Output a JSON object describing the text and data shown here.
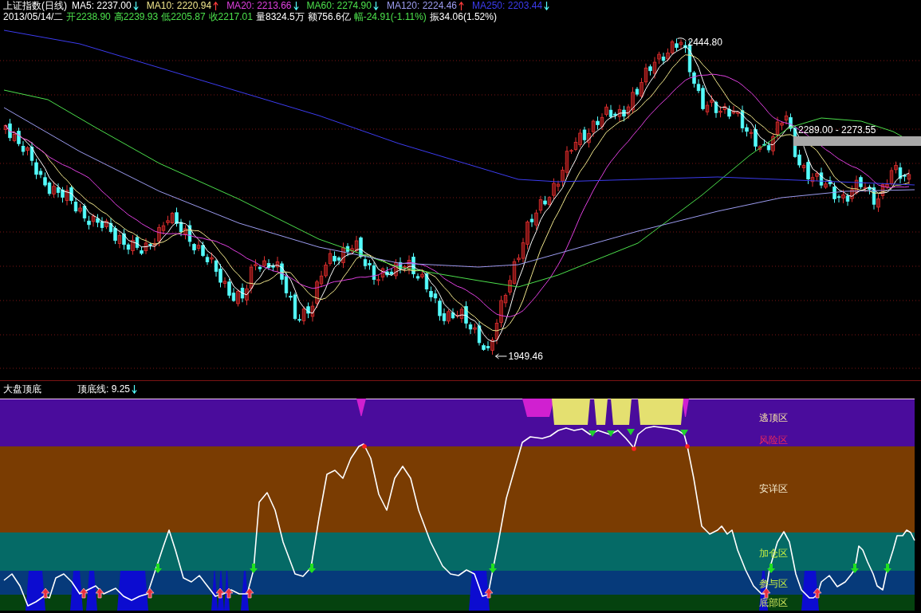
{
  "quote_header": {
    "title": "上证指数(日线)",
    "moving_averages": [
      {
        "label": "MA5: 2237.00",
        "color": "#ffffff",
        "rising": false
      },
      {
        "label": "MA10: 2220.94",
        "color": "#f0e68c",
        "rising": true
      },
      {
        "label": "MA20: 2213.66",
        "color": "#e040e0",
        "rising": false
      },
      {
        "label": "MA60: 2274.90",
        "color": "#4ce04c",
        "rising": false
      },
      {
        "label": "MA120: 2224.46",
        "color": "#9c9cf0",
        "rising": true
      },
      {
        "label": "MA250: 2203.44",
        "color": "#3c3cf0",
        "rising": false
      }
    ],
    "date": "2013/05/14/二",
    "fields": [
      {
        "text": "开2238.90",
        "color": "#4ce04c"
      },
      {
        "text": "高2239.93",
        "color": "#4ce04c"
      },
      {
        "text": "低2205.87",
        "color": "#4ce04c"
      },
      {
        "text": "收2217.01",
        "color": "#4ce04c"
      },
      {
        "text": "量8324.5万",
        "color": "#ffffff"
      },
      {
        "text": "额756.6亿",
        "color": "#ffffff"
      },
      {
        "text": "幅-24.91(-1.11%)",
        "color": "#4ce04c"
      },
      {
        "text": "振34.06(1.52%)",
        "color": "#ffffff"
      }
    ]
  },
  "price_chart": {
    "high_label": "2444.80",
    "low_label": "1949.46",
    "range_label": "2289.00 - 2273.55"
  },
  "indicator_panel": {
    "title": "大盘顶底",
    "line_label": "顶底线: 9.25",
    "rising": false,
    "zones": [
      {
        "color": "#4a0c9c",
        "labels": [
          "逃顶区",
          "风险区"
        ]
      },
      {
        "color": "#7a3c02",
        "labels": [
          "安详区"
        ]
      },
      {
        "color": "#056a66",
        "labels": [
          "加仓区"
        ]
      },
      {
        "color": "#063a7a",
        "labels": [
          "参与区"
        ]
      },
      {
        "color": "#05420f",
        "labels": [
          "底部区"
        ]
      }
    ]
  }
}
